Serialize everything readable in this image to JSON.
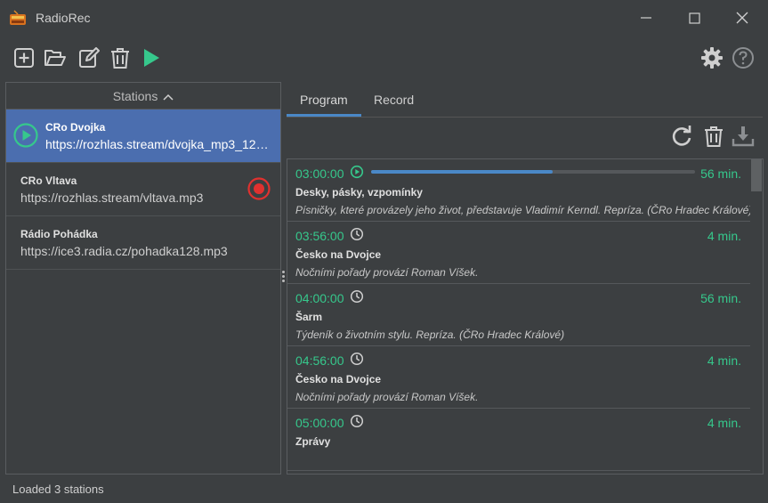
{
  "window": {
    "title": "RadioRec",
    "icon": "radio-icon",
    "controls": [
      "minimize-icon",
      "maximize-icon",
      "close-icon"
    ]
  },
  "toolbar": {
    "buttons": [
      "add-icon",
      "open-folder-icon",
      "edit-icon",
      "delete-icon",
      "play-icon"
    ],
    "right_buttons": [
      "settings-icon",
      "help-icon"
    ]
  },
  "stations": {
    "header": "Stations",
    "sort": "ascending",
    "items": [
      {
        "name": "CRo Dvojka",
        "url": "https://rozhlas.stream/dvojka_mp3_12…",
        "state": "playing",
        "selected": true
      },
      {
        "name": "CRo Vltava",
        "url": "https://rozhlas.stream/vltava.mp3",
        "state": "recording",
        "selected": false
      },
      {
        "name": "Rádio Pohádka",
        "url": "https://ice3.radia.cz/pohadka128.mp3",
        "state": "",
        "selected": false
      }
    ]
  },
  "tabs": [
    {
      "label": "Program",
      "active": true
    },
    {
      "label": "Record",
      "active": false
    }
  ],
  "program_actions": [
    "refresh-icon",
    "delete-icon",
    "download-icon"
  ],
  "program": [
    {
      "time": "03:00:00",
      "status": "playing",
      "progress": 0.56,
      "duration": "56 min.",
      "title": "Desky, pásky, vzpomínky",
      "desc": "Písničky, které provázely jeho život, představuje Vladimír Kerndl. Repríza. (ČRo Hradec Králové)"
    },
    {
      "time": "03:56:00",
      "status": "scheduled",
      "duration": "4 min.",
      "title": "Česko na Dvojce",
      "desc": "Nočními pořady provází Roman Víšek."
    },
    {
      "time": "04:00:00",
      "status": "scheduled",
      "duration": "56 min.",
      "title": "Šarm",
      "desc": "Týdeník o životním stylu. Repríza. (ČRo Hradec Králové)"
    },
    {
      "time": "04:56:00",
      "status": "scheduled",
      "duration": "4 min.",
      "title": "Česko na Dvojce",
      "desc": "Nočními pořady provází Roman Víšek."
    },
    {
      "time": "05:00:00",
      "status": "scheduled",
      "duration": "4 min.",
      "title": "Zprávy",
      "desc": ""
    }
  ],
  "status": "Loaded 3 stations",
  "colors": {
    "accent_green": "#36c88c",
    "selection_blue": "#4b6eaf",
    "record_red": "#e0312f",
    "progress_blue": "#4a88c7"
  }
}
